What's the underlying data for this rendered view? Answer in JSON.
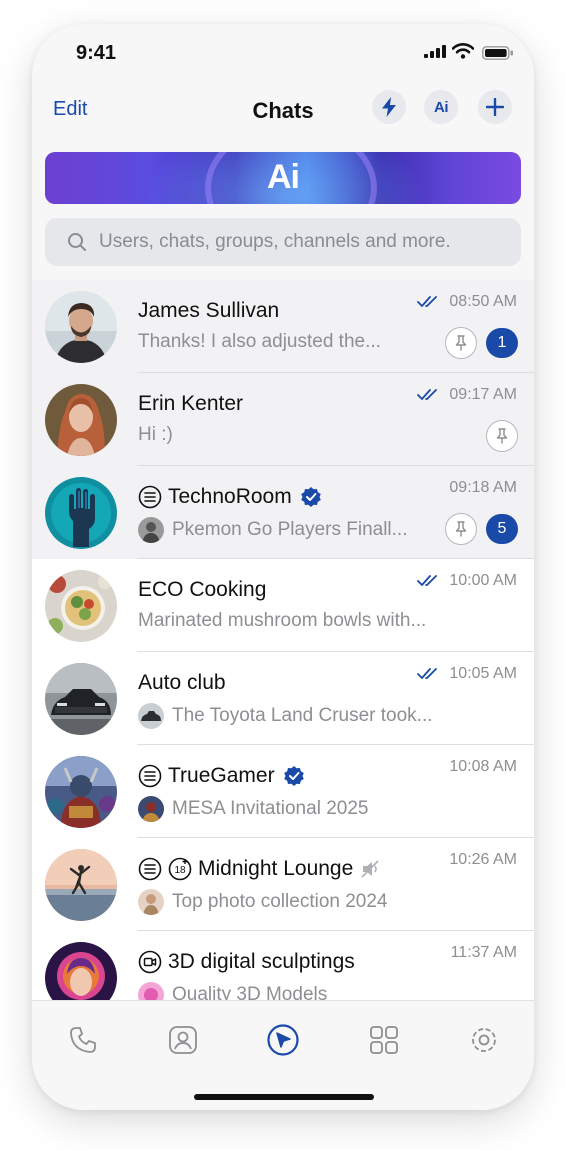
{
  "status_bar": {
    "time": "9:41"
  },
  "header": {
    "edit_label": "Edit",
    "title": "Chats",
    "ai_button_label": "Ai"
  },
  "banner": {
    "label": "Ai"
  },
  "search": {
    "placeholder": "Users, chats, groups, channels and more."
  },
  "chats": [
    {
      "name": "James Sullivan",
      "message": "Thanks! I also adjusted the...",
      "time": "08:50 AM",
      "read": true,
      "pinned": true,
      "unread": "1"
    },
    {
      "name": "Erin Kenter",
      "message": "Hi :)",
      "time": "09:17 AM",
      "read": true,
      "pinned": true
    },
    {
      "name": "TechnoRoom",
      "message": "Pkemon Go Players Finall...",
      "time": "09:18 AM",
      "type": "channel",
      "verified": true,
      "pinned": true,
      "unread": "5"
    },
    {
      "name": "ECO Cooking",
      "message": "Marinated mushroom bowls with...",
      "time": "10:00 AM",
      "read": true
    },
    {
      "name": "Auto club",
      "message": "The Toyota Land Cruser took...",
      "time": "10:05 AM",
      "read": true
    },
    {
      "name": "TrueGamer",
      "message": "MESA Invitational 2025",
      "time": "10:08 AM",
      "type": "channel",
      "verified": true
    },
    {
      "name": "Midnight Lounge",
      "message": "Top photo collection 2024",
      "time": "10:26 AM",
      "type": "channel",
      "age_restricted": "18",
      "muted": true
    },
    {
      "name": "3D digital sculptings",
      "message": "Quality 3D Models",
      "time": "11:37 AM",
      "type": "video-channel"
    }
  ],
  "tab_bar": [
    "phone-icon",
    "contacts-icon",
    "chats-icon",
    "apps-icon",
    "settings-icon"
  ],
  "colors": {
    "accent": "#1a4aa8",
    "secondary_text": "#8e8e93"
  }
}
